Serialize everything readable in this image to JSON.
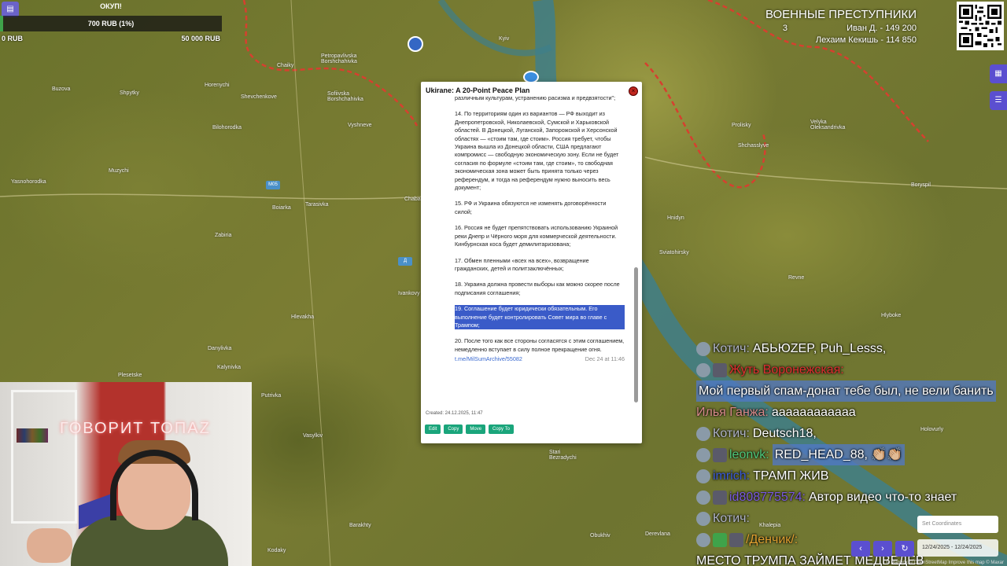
{
  "donation": {
    "title": "ОКУП!",
    "amount": "700 RUB (1%)",
    "progress_fraction": 0.014,
    "min": "0 RUB",
    "max": "50 000 RUB",
    "icon": "bookmark-icon"
  },
  "criminals": {
    "heading": "ВОЕННЫЕ ПРЕСТУПНИКИ",
    "row1_left": "Иван Д. - 149 200",
    "row1_count": "3",
    "row2": "Лехаим Кекишь - 114 850"
  },
  "map": {
    "towns": [
      "Kyiv",
      "Petropavlivska Borshchahivka",
      "Chaiky",
      "Buzova",
      "Shpytky",
      "Horenychi",
      "Sofiivska Borshchahivka",
      "Shevchenkove",
      "Bilohorodka",
      "Vyshneve",
      "Muzychi",
      "Yasnohorodka",
      "Boiarka",
      "Tarasivka",
      "Zabiria",
      "Chaba",
      "Ivankovy",
      "Hlevakha",
      "Danylivka",
      "Kalynivka",
      "Plesetske",
      "Putrivka",
      "Vasylkiv",
      "Barakhty",
      "Kodaky",
      "Stari Bezradychi",
      "Obukhiv",
      "Derevlana",
      "Prolisky",
      "Velyka Oleksandrivka",
      "Shchasslyve",
      "Boryspil",
      "Hnidyn",
      "Sviatohirsky",
      "Revne",
      "Hlyboke",
      "Holovurly",
      "Khalepia"
    ],
    "badges": [
      "М05",
      "Д"
    ]
  },
  "popup": {
    "title": "Ukirane: A 20-Point Peace Plan",
    "close_icon": "close-icon",
    "paragraphs": [
      "различным культурам, устранению расизма и предвзятости\";",
      "14. По территориям один из вариантов — РФ выходит из Днепропетровской, Николаевской, Сумской и Харьковской областей. В Донецкой, Луганской, Запорожской и Херсонской областях — «стоим там, где стоим». Россия требует, чтобы Украина вышла из Донецкой области, США предлагают компромисс — свободную экономическую зону. Если не будет согласия по формуле «стоим там, где стоим», то свободная экономическая зона может быть принята только через референдум, и тогда на референдум нужно выносить весь документ;",
      "15. РФ и Украина обязуются не изменять договорённости силой;",
      "16. Россия не будет препятствовать использованию Украиной реки Днепр и Чёрного моря для коммерческой деятельности. Кинбурнская коса будет демилитаризована;",
      "17. Обмен пленными «всех на всех», возвращение гражданских, детей и политзаключённых;",
      "18. Украина должна провести выборы как можно скорее после подписания соглашения;"
    ],
    "selected_paragraph": "19. Соглашение будет юридически обязательным. Его выполнение будет контролировать Совет мира во главе с Трампом;",
    "last_paragraph": "20. После того как все стороны согласятся с этим соглашением, немедленно вступает в силу полное прекращение огня.",
    "link": "t.me/MilSumArchive/55082",
    "date": "Dec 24 at 11:46",
    "created": "Created: 24.12.2025, 11:47",
    "buttons": [
      "Edit",
      "Copy",
      "Move",
      "Copy To"
    ]
  },
  "webcam": {
    "neon_sign": "ГОВОРИТ ТОПАZ"
  },
  "chat": [
    {
      "name": "Котич:",
      "name_class": "n-gray",
      "text": "АБЬЮZEP, Puh_Lesss,",
      "highlight": false
    },
    {
      "name": "Жуть Воронежская:",
      "name_class": "n-red",
      "text": "Мой первый спам-донат тебе был, не вели банить",
      "highlight": true
    },
    {
      "name": "Илья Ганжа:",
      "name_class": "n-pink",
      "text": "аааааааааааа",
      "highlight": false
    },
    {
      "name": "Котич:",
      "name_class": "n-gray",
      "text": "Deutsch18,",
      "highlight": false
    },
    {
      "name": "leonvk:",
      "name_class": "n-green",
      "text": "RED_HEAD_88, 👏🏼👏🏼",
      "highlight": true
    },
    {
      "name": "imrich:",
      "name_class": "n-blue",
      "text": "ТРАМП ЖИВ",
      "highlight": false
    },
    {
      "name": "id808775574:",
      "name_class": "n-purple",
      "text": "Автор видео что-то знает",
      "highlight": false
    },
    {
      "name": "Котич:",
      "name_class": "n-gray",
      "text": "",
      "highlight": false
    },
    {
      "name": "/Денчик/:",
      "name_class": "n-orange",
      "text": "МЕСТО ТРУМПА ЗАЙМЕТ МЕДВЕДЕВ",
      "highlight": false
    }
  ],
  "coords": {
    "placeholder": "Set Coordinates",
    "dates": "12/24/2025 - 12/24/2025"
  },
  "attribution": "© Mapbox © OpenStreetMap Improve this map © Maxar"
}
